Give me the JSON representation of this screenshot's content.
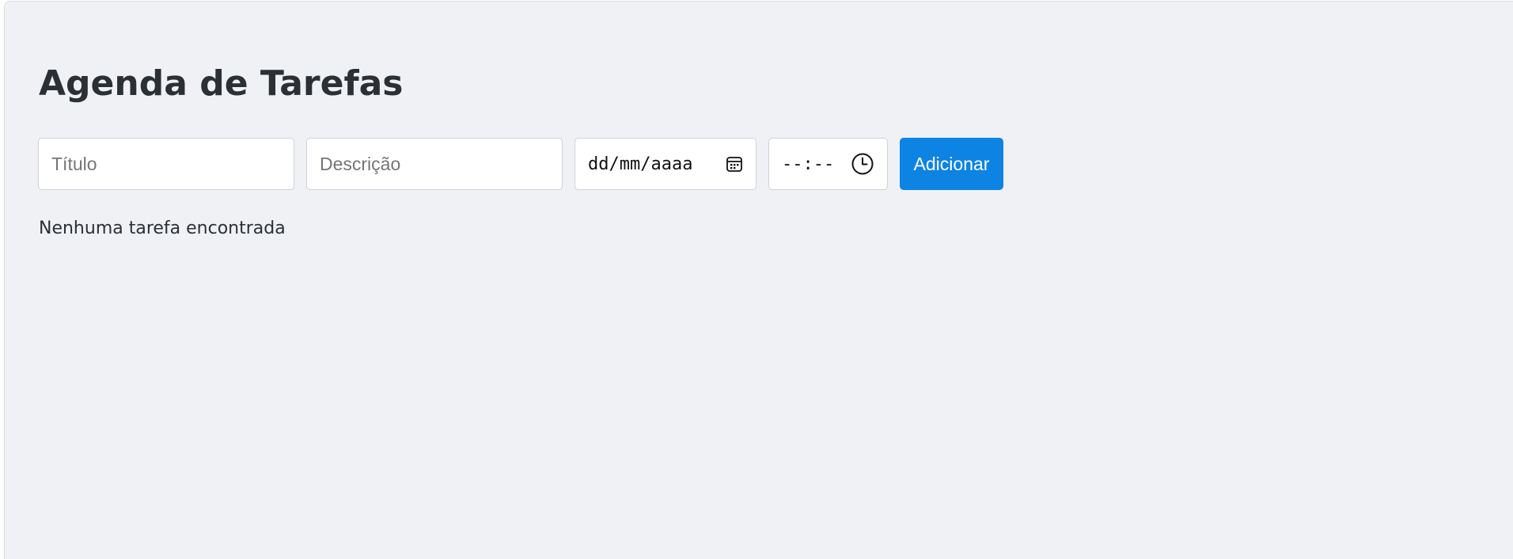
{
  "page": {
    "title": "Agenda de Tarefas"
  },
  "form": {
    "title_input": {
      "placeholder": "Título",
      "value": ""
    },
    "description_input": {
      "placeholder": "Descrição",
      "value": ""
    },
    "date_input": {
      "display": "dd/mm/aaaa",
      "icon": "calendar-icon"
    },
    "time_input": {
      "display": "--:--",
      "icon": "clock-icon"
    },
    "add_button_label": "Adicionar"
  },
  "task_list": {
    "empty_message": "Nenhuma tarefa encontrada"
  },
  "colors": {
    "background": "#f0f1f4",
    "accent": "#0d83e3",
    "text": "#2b3035"
  }
}
